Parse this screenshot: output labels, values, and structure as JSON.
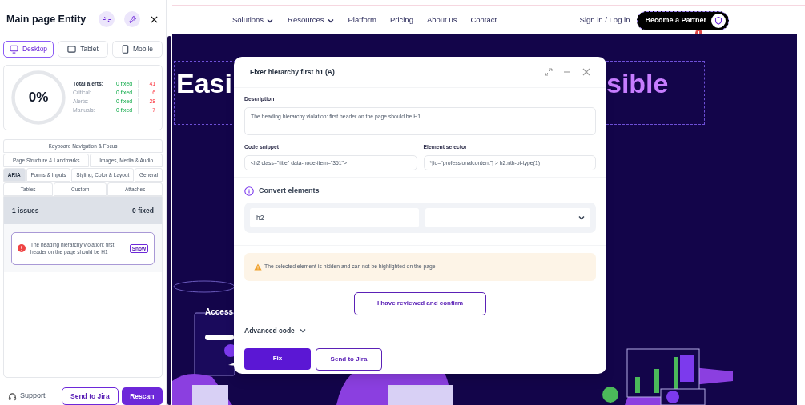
{
  "panel": {
    "title": "Main page Entity",
    "devices": [
      {
        "label": "Desktop",
        "kind": "desktop",
        "selected": true
      },
      {
        "label": "Tablet",
        "kind": "tablet",
        "selected": false
      },
      {
        "label": "Mobile",
        "kind": "mobile",
        "selected": false
      }
    ],
    "summary": {
      "percent": "0%",
      "rows": [
        {
          "label": "Total alerts:",
          "fixed": "0 fixed",
          "count": "41",
          "strong": true
        },
        {
          "label": "Critical:",
          "fixed": "0 fixed",
          "count": "6",
          "strong": false
        },
        {
          "label": "Alerts:",
          "fixed": "0 fixed",
          "count": "28",
          "strong": false
        },
        {
          "label": "Manuals:",
          "fixed": "0 fixed",
          "count": "7",
          "strong": false
        }
      ]
    },
    "categories": [
      [
        {
          "label": "Keyboard Navigation & Focus",
          "selected": false
        }
      ],
      [
        {
          "label": "Page Structure & Landmarks",
          "selected": false
        },
        {
          "label": "Images, Media & Audio",
          "selected": false
        }
      ],
      [
        {
          "label": "ARIA",
          "selected": true
        },
        {
          "label": "Forms & Inputs",
          "selected": false
        },
        {
          "label": "Styling, Color & Layout",
          "selected": false
        },
        {
          "label": "General",
          "selected": false
        }
      ],
      [
        {
          "label": "Tables",
          "selected": false
        },
        {
          "label": "Custom",
          "selected": false
        },
        {
          "label": "Attaches",
          "selected": false
        }
      ]
    ],
    "issues_header": {
      "count": "1 issues",
      "fixed": "0 fixed"
    },
    "issues": [
      {
        "text": "The heading hierarchy violation: first header on the page should be H1",
        "action": "Show"
      }
    ],
    "footer": {
      "support": "Support",
      "send": "Send to Jira",
      "rescan": "Rescan"
    }
  },
  "site": {
    "nav": [
      {
        "label": "Solutions",
        "dropdown": true
      },
      {
        "label": "Resources",
        "dropdown": true
      },
      {
        "label": "Platform",
        "dropdown": false
      },
      {
        "label": "Pricing",
        "dropdown": false
      },
      {
        "label": "About us",
        "dropdown": false
      },
      {
        "label": "Contact",
        "dropdown": false
      }
    ],
    "signin": "Sign in / Log in",
    "partner": "Become a Partner",
    "hero": {
      "heading_left": "Easi",
      "heading_right": "sible",
      "card_title": "Access"
    }
  },
  "modal": {
    "title": "Fixer hierarchy first h1 (A)",
    "description": {
      "label": "Description",
      "value": "The heading hierarchy violation: first header on the page should be H1"
    },
    "code_snippet": {
      "label": "Code snippet",
      "value": "<h2 class=\"title\" data-node-item=\"351\">"
    },
    "element_selector": {
      "label": "Element selector",
      "value": "*[id=\"professionalcontent\"] > h2:nth-of-type(1)"
    },
    "convert": {
      "title": "Convert elements",
      "from": "h2"
    },
    "warning": "The selected element is hidden and can not be highlighted on the page",
    "confirm": "I have reviewed and confirm",
    "advanced": "Advanced code",
    "fix": "Fix",
    "send": "Send to Jira"
  }
}
